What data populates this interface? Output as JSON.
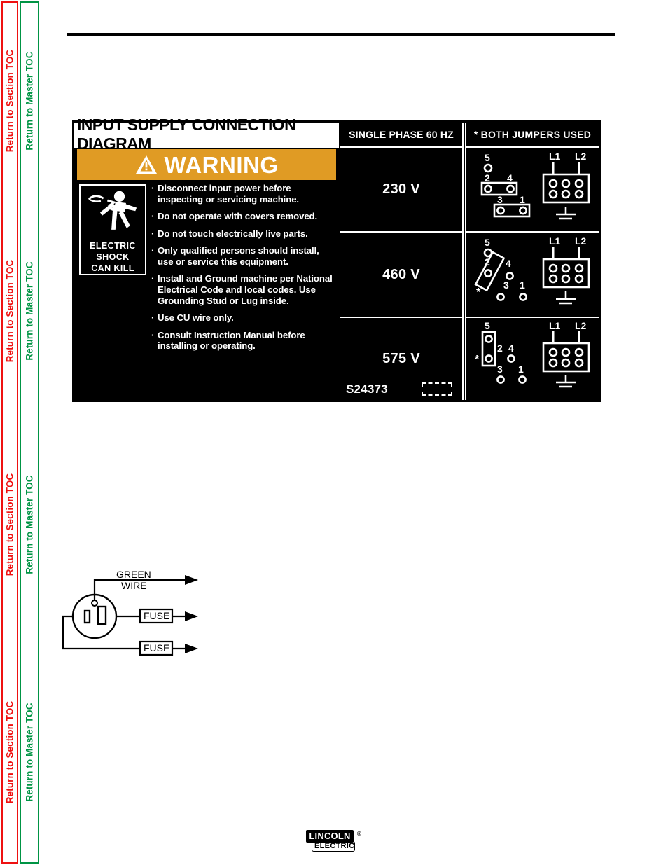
{
  "sidebar": {
    "section_toc_label": "Return to Section TOC",
    "master_toc_label": "Return to Master TOC",
    "section_color": "#ee1111",
    "master_color": "#009444",
    "repeat_count": 4
  },
  "diagram": {
    "header": {
      "title": "INPUT SUPPLY CONNECTION DIAGRAM",
      "phase": "SINGLE PHASE  60 HZ",
      "jumpers": "*  BOTH JUMPERS USED"
    },
    "warning": {
      "banner_label": "WARNING",
      "banner_color": "#e09b24",
      "icon_name": "electric-shock-figure-icon",
      "icon_caption_lines": [
        "ELECTRIC",
        "SHOCK",
        "CAN KILL"
      ],
      "bullets": [
        "Disconnect input power before inspecting or servicing machine.",
        "Do not operate with covers removed.",
        "Do not touch electrically live parts.",
        "Only qualified persons should install, use or service this equipment.",
        "Install and Ground machine per National Electrical Code and local codes. Use Grounding Stud or Lug inside.",
        "Use CU wire only.",
        "Consult Instruction Manual before installing or operating."
      ]
    },
    "rows": [
      {
        "voltage": "230 V",
        "terminal_labels": [
          "5",
          "2",
          "4",
          "3",
          "1"
        ],
        "jumper_note": "",
        "block_labels": [
          "L1",
          "L2"
        ],
        "ground_symbol": "earth-ground"
      },
      {
        "voltage": "460 V",
        "terminal_labels": [
          "5",
          "2",
          "4",
          "3",
          "1"
        ],
        "jumper_note": "*",
        "block_labels": [
          "L1",
          "L2"
        ],
        "ground_symbol": "earth-ground"
      },
      {
        "voltage": "575 V",
        "terminal_labels": [
          "5",
          "2",
          "4",
          "3",
          "1"
        ],
        "jumper_note": "*",
        "block_labels": [
          "L1",
          "L2"
        ],
        "ground_symbol": "earth-ground"
      }
    ],
    "part_number": "S24373"
  },
  "receptacle": {
    "green_wire_line1": "GREEN",
    "green_wire_line2": "WIRE",
    "fuse_label_1": "FUSE",
    "fuse_label_2": "FUSE"
  },
  "footer": {
    "logo_line1": "LINCOLN",
    "logo_line2": "ELECTRIC",
    "registered_mark": "®"
  }
}
